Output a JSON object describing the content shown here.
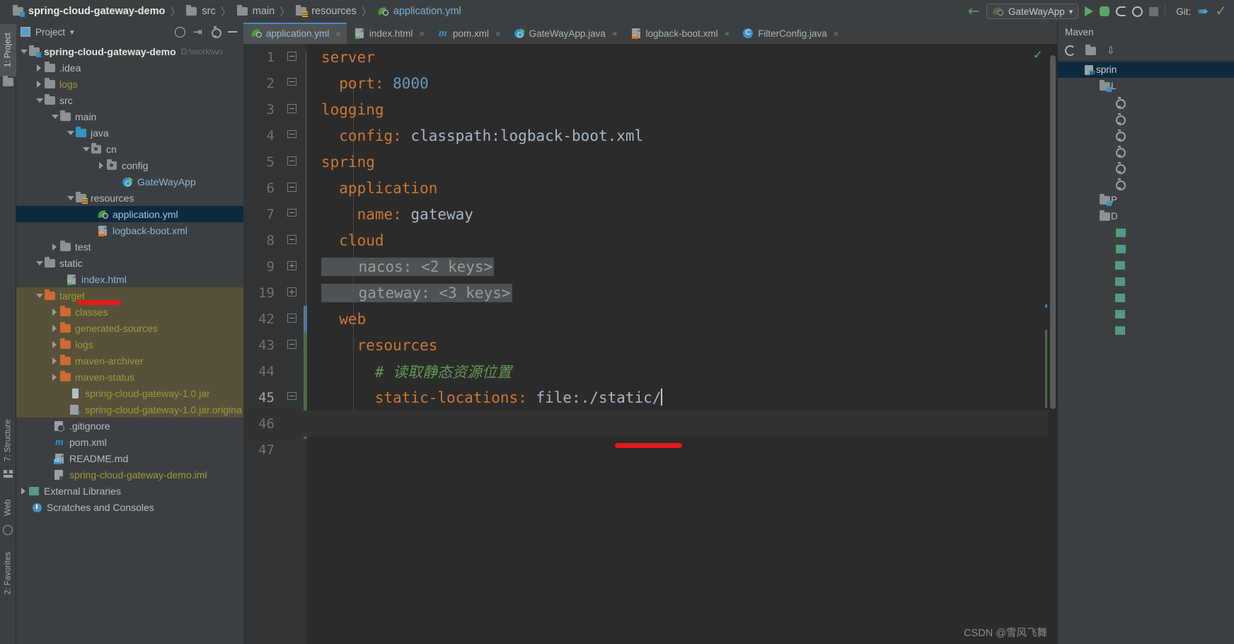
{
  "breadcrumb": {
    "items": [
      {
        "label": "spring-cloud-gateway-demo",
        "icon": "module-folder-icon",
        "kind": "root"
      },
      {
        "label": "src",
        "icon": "folder-icon",
        "kind": "folder"
      },
      {
        "label": "main",
        "icon": "folder-icon",
        "kind": "folder"
      },
      {
        "label": "resources",
        "icon": "resources-folder-icon",
        "kind": "folder"
      },
      {
        "label": "application.yml",
        "icon": "yaml-file-icon",
        "kind": "leaf"
      }
    ],
    "separator": "〉"
  },
  "toolbar": {
    "back_icon": "back-arrow-icon",
    "run_config": {
      "label": "GateWayApp",
      "icon": "spring-boot-icon",
      "caret": "▾"
    },
    "run_icon": "run-icon",
    "debug_icon": "debug-icon",
    "run_coverage_icon": "run-with-coverage-icon",
    "profile_icon": "profiler-icon",
    "stop_icon": "stop-icon",
    "git_label": "Git:",
    "git_update_icon": "update-project-icon",
    "git_commit_icon": "commit-icon"
  },
  "left_tool_window_bar": {
    "tabs": [
      {
        "label": "1: Project",
        "active": true,
        "icon": "project-icon"
      },
      {
        "label": "7: Structure",
        "active": false,
        "icon": "structure-icon"
      },
      {
        "label": "Web",
        "active": false,
        "icon": "web-icon"
      },
      {
        "label": "2: Favorites",
        "active": false,
        "icon": "favorites-icon"
      }
    ]
  },
  "project_panel": {
    "title": "Project",
    "title_caret": "▾",
    "header_icons": [
      "locate-icon",
      "collapse-all-icon",
      "settings-gear-icon",
      "hide-icon"
    ],
    "tree": [
      {
        "label": "spring-cloud-gateway-demo",
        "sub": "D:\\work\\wo",
        "depth": 0,
        "arrow": "down",
        "icon": "module-folder-icon",
        "color": "#e4e4e4",
        "bold": true
      },
      {
        "label": ".idea",
        "depth": 1,
        "arrow": "right",
        "icon": "folder-icon",
        "color": "#bbbbbb"
      },
      {
        "label": "logs",
        "depth": 1,
        "arrow": "right",
        "icon": "folder-icon",
        "color": "#9c9a3a"
      },
      {
        "label": "src",
        "depth": 1,
        "arrow": "down",
        "icon": "folder-icon",
        "color": "#bbbbbb"
      },
      {
        "label": "main",
        "depth": 2,
        "arrow": "down",
        "icon": "folder-icon",
        "color": "#bbbbbb"
      },
      {
        "label": "java",
        "depth": 3,
        "arrow": "down",
        "icon": "sources-folder-icon",
        "color": "#bbbbbb"
      },
      {
        "label": "cn",
        "depth": 4,
        "arrow": "down",
        "icon": "package-icon",
        "color": "#bbbbbb"
      },
      {
        "label": "config",
        "depth": 5,
        "arrow": "right",
        "icon": "package-icon",
        "color": "#bbbbbb"
      },
      {
        "label": "GateWayApp",
        "depth": 6,
        "arrow": "none",
        "icon": "spring-boot-class-icon",
        "color": "#8ab4d8"
      },
      {
        "label": "resources",
        "depth": 3,
        "arrow": "down",
        "icon": "resources-folder-icon",
        "color": "#bbbbbb"
      },
      {
        "label": "application.yml",
        "depth": 5,
        "arrow": "none",
        "icon": "yaml-file-icon",
        "color": "#8ab4d8",
        "selected": true
      },
      {
        "label": "logback-boot.xml",
        "depth": 5,
        "arrow": "none",
        "icon": "xml-file-icon",
        "color": "#8ab4d8"
      },
      {
        "label": "test",
        "depth": 2,
        "arrow": "right",
        "icon": "folder-icon",
        "color": "#bbbbbb"
      },
      {
        "label": "static",
        "depth": 1,
        "arrow": "down",
        "icon": "folder-icon",
        "color": "#bbbbbb"
      },
      {
        "label": "index.html",
        "depth": 3,
        "arrow": "none",
        "icon": "html-file-icon",
        "color": "#8ab4d8",
        "underline": "red"
      },
      {
        "label": "target",
        "depth": 1,
        "arrow": "down",
        "icon": "excluded-folder-icon",
        "color": "#9c9a3a",
        "excluded": true
      },
      {
        "label": "classes",
        "depth": 2,
        "arrow": "right",
        "icon": "excluded-folder-icon",
        "color": "#9c9a3a",
        "excluded": true
      },
      {
        "label": "generated-sources",
        "depth": 2,
        "arrow": "right",
        "icon": "excluded-folder-icon",
        "color": "#9c9a3a",
        "excluded": true
      },
      {
        "label": "logs",
        "depth": 2,
        "arrow": "right",
        "icon": "excluded-folder-icon",
        "color": "#9c9a3a",
        "excluded": true
      },
      {
        "label": "maven-archiver",
        "depth": 2,
        "arrow": "right",
        "icon": "excluded-folder-icon",
        "color": "#9c9a3a",
        "excluded": true
      },
      {
        "label": "maven-status",
        "depth": 2,
        "arrow": "right",
        "icon": "excluded-folder-icon",
        "color": "#9c9a3a",
        "excluded": true
      },
      {
        "label": "spring-cloud-gateway-1.0.jar",
        "depth": 3,
        "arrow": "none",
        "icon": "jar-file-icon",
        "color": "#9c9a3a",
        "excluded": true
      },
      {
        "label": "spring-cloud-gateway-1.0.jar.origina",
        "depth": 3,
        "arrow": "none",
        "icon": "unknown-file-icon",
        "color": "#9c9a3a",
        "excluded": true
      },
      {
        "label": ".gitignore",
        "depth": 2,
        "arrow": "none",
        "icon": "gitignore-file-icon",
        "color": "#bbbbbb"
      },
      {
        "label": "pom.xml",
        "depth": 2,
        "arrow": "none",
        "icon": "maven-pom-icon",
        "color": "#bbbbbb"
      },
      {
        "label": "README.md",
        "depth": 2,
        "arrow": "none",
        "icon": "markdown-file-icon",
        "color": "#bbbbbb"
      },
      {
        "label": "spring-cloud-gateway-demo.iml",
        "depth": 2,
        "arrow": "none",
        "icon": "iml-file-icon",
        "color": "#9c9a3a"
      },
      {
        "label": "External Libraries",
        "depth": 0,
        "arrow": "right",
        "icon": "libraries-icon",
        "color": "#bbbbbb"
      },
      {
        "label": "Scratches and Consoles",
        "depth": 0,
        "arrow": "none",
        "icon": "scratches-icon",
        "color": "#bbbbbb"
      }
    ]
  },
  "editor": {
    "tabs": [
      {
        "label": "application.yml",
        "icon": "yaml-file-icon",
        "active": true,
        "close": "×"
      },
      {
        "label": "index.html",
        "icon": "html-file-icon",
        "active": false,
        "close": "×"
      },
      {
        "label": "pom.xml",
        "icon": "maven-pom-icon",
        "active": false,
        "close": "×"
      },
      {
        "label": "GateWayApp.java",
        "icon": "spring-boot-class-icon",
        "active": false,
        "close": "×"
      },
      {
        "label": "logback-boot.xml",
        "icon": "xml-file-icon",
        "active": false,
        "close": "×"
      },
      {
        "label": "FilterConfig.java",
        "icon": "java-class-icon",
        "active": false,
        "close": "×"
      }
    ],
    "inspection_status_icon": "ok-check-icon",
    "lines": [
      {
        "num": "1",
        "indent": 0,
        "fold": "collapse-top",
        "segments": [
          {
            "t": "server",
            "c": "k"
          },
          {
            "t": ":",
            "c": "k"
          }
        ]
      },
      {
        "num": "2",
        "indent": 1,
        "fold": "collapse-bottom",
        "segments": [
          {
            "t": "  port",
            "c": "k"
          },
          {
            "t": ": ",
            "c": "k"
          },
          {
            "t": "8000",
            "c": "n"
          }
        ]
      },
      {
        "num": "3",
        "indent": 0,
        "fold": "collapse-top",
        "segments": [
          {
            "t": "logging",
            "c": "k"
          },
          {
            "t": ":",
            "c": "k"
          }
        ]
      },
      {
        "num": "4",
        "indent": 1,
        "fold": "collapse-bottom",
        "segments": [
          {
            "t": "  config",
            "c": "k"
          },
          {
            "t": ": ",
            "c": "k"
          },
          {
            "t": "classpath:logback-boot.xml",
            "c": "v"
          }
        ]
      },
      {
        "num": "5",
        "indent": 0,
        "fold": "collapse-top",
        "segments": [
          {
            "t": "spring",
            "c": "k"
          },
          {
            "t": ":",
            "c": "k"
          }
        ]
      },
      {
        "num": "6",
        "indent": 1,
        "fold": "collapse-top",
        "segments": [
          {
            "t": "  application",
            "c": "k"
          },
          {
            "t": ":",
            "c": "k"
          }
        ]
      },
      {
        "num": "7",
        "indent": 2,
        "fold": "collapse-bottom",
        "segments": [
          {
            "t": "    name",
            "c": "k"
          },
          {
            "t": ": ",
            "c": "k"
          },
          {
            "t": "gateway",
            "c": "v"
          }
        ]
      },
      {
        "num": "8",
        "indent": 1,
        "fold": "collapse-top",
        "segments": [
          {
            "t": "  cloud",
            "c": "k"
          },
          {
            "t": ":",
            "c": "k"
          }
        ]
      },
      {
        "num": "9",
        "indent": 2,
        "fold": "expand",
        "folded": true,
        "segments": [
          {
            "t": "    nacos: <2 keys>",
            "c": "fold"
          }
        ]
      },
      {
        "num": "19",
        "indent": 2,
        "fold": "expand",
        "folded": true,
        "segments": [
          {
            "t": "    gateway: <3 keys>",
            "c": "fold"
          }
        ]
      },
      {
        "num": "42",
        "indent": 1,
        "fold": "collapse-top",
        "segments": [
          {
            "t": "  web",
            "c": "k"
          },
          {
            "t": ":",
            "c": "k"
          }
        ]
      },
      {
        "num": "43",
        "indent": 2,
        "fold": "collapse-top",
        "segments": [
          {
            "t": "    resources",
            "c": "k"
          },
          {
            "t": ":",
            "c": "k"
          }
        ]
      },
      {
        "num": "44",
        "indent": 3,
        "fold": "none",
        "segments": [
          {
            "t": "      # 读取静态资源位置",
            "c": "cm"
          }
        ]
      },
      {
        "num": "45",
        "indent": 3,
        "fold": "collapse-bottom",
        "current": true,
        "segments": [
          {
            "t": "      static-locations",
            "c": "k"
          },
          {
            "t": ": ",
            "c": "k"
          },
          {
            "t": "file:./static/",
            "c": "v"
          }
        ],
        "caret": true
      },
      {
        "num": "46",
        "indent": 0,
        "fold": "none",
        "segments": []
      },
      {
        "num": "47",
        "indent": 0,
        "fold": "none",
        "segments": []
      }
    ]
  },
  "maven_panel": {
    "title": "Maven",
    "toolbar_icons": [
      "reimport-icon",
      "generate-sources-icon",
      "download-sources-icon"
    ],
    "tree": [
      {
        "label": "sprin",
        "depth": 0,
        "arrow": "down",
        "icon": "maven-project-icon",
        "selected": true
      },
      {
        "label": "L",
        "depth": 1,
        "arrow": "down",
        "icon": "lifecycle-folder-icon"
      },
      {
        "label": "",
        "depth": 2,
        "arrow": "none",
        "icon": "maven-goal-icon"
      },
      {
        "label": "",
        "depth": 2,
        "arrow": "none",
        "icon": "maven-goal-icon"
      },
      {
        "label": "",
        "depth": 2,
        "arrow": "none",
        "icon": "maven-goal-icon"
      },
      {
        "label": "",
        "depth": 2,
        "arrow": "none",
        "icon": "maven-goal-icon"
      },
      {
        "label": "",
        "depth": 2,
        "arrow": "none",
        "icon": "maven-goal-icon"
      },
      {
        "label": "",
        "depth": 2,
        "arrow": "none",
        "icon": "maven-goal-icon"
      },
      {
        "label": "P",
        "depth": 1,
        "arrow": "right",
        "icon": "plugins-folder-icon"
      },
      {
        "label": "D",
        "depth": 1,
        "arrow": "down",
        "icon": "dependencies-folder-icon"
      },
      {
        "label": "",
        "depth": 2,
        "arrow": "none",
        "icon": "library-icon"
      },
      {
        "label": "",
        "depth": 2,
        "arrow": "none",
        "icon": "library-icon"
      },
      {
        "label": "",
        "depth": 2,
        "arrow": "right",
        "icon": "library-icon"
      },
      {
        "label": "",
        "depth": 2,
        "arrow": "right",
        "icon": "library-icon"
      },
      {
        "label": "",
        "depth": 2,
        "arrow": "right",
        "icon": "library-icon"
      },
      {
        "label": "",
        "depth": 2,
        "arrow": "right",
        "icon": "library-icon"
      },
      {
        "label": "",
        "depth": 2,
        "arrow": "down",
        "icon": "library-icon"
      }
    ]
  },
  "watermark": {
    "text": "CSDN @雪风飞舞"
  },
  "colors": {
    "panel_bg": "#3c3f41",
    "editor_bg": "#2b2b2b",
    "selection_blue": "#0d293e",
    "excluded_bg": "#585139",
    "accent_orange": "#cc7832",
    "value_blue": "#a9b7c6",
    "number_blue": "#6897bb",
    "comment_green": "#629755",
    "annotation_red": "#e01b1b"
  }
}
